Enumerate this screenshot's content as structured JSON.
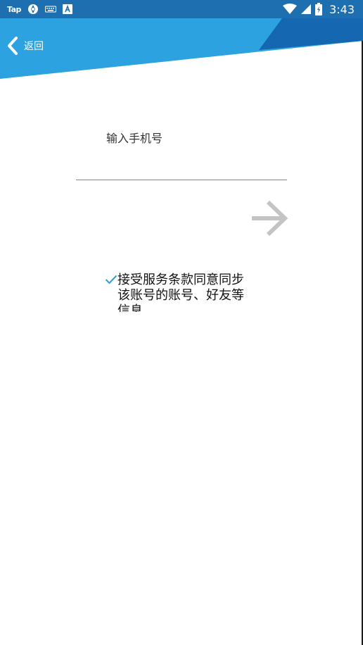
{
  "status_bar": {
    "app_text": "Tap",
    "time": "3:43"
  },
  "header": {
    "back_label": "返回"
  },
  "form": {
    "phone_label": "输入手机号",
    "phone_value": ""
  },
  "agreement": {
    "text": "接受服务条款同意同步该账号的账号、好友等信息",
    "checked": true
  },
  "colors": {
    "header_light": "#2ca3e0",
    "header_dark": "#1467b0",
    "status_bar": "#1e6fb0",
    "input_underline": "#2b9fd9",
    "check": "#2b9fd9",
    "next_arrow": "#c4c4c4"
  },
  "icons": {
    "back": "chevron-left-icon",
    "next": "arrow-right-icon",
    "check": "check-icon"
  }
}
